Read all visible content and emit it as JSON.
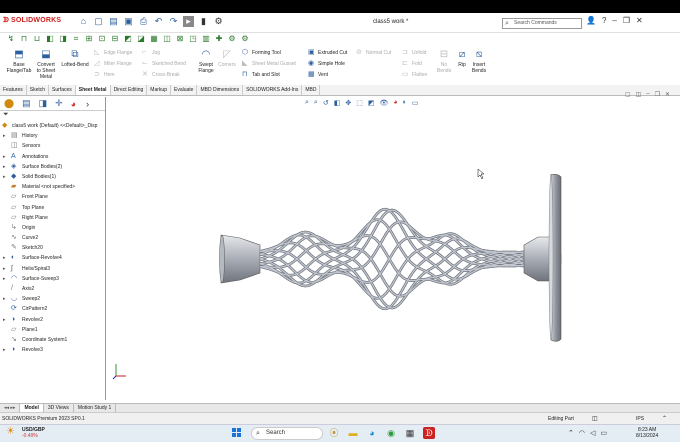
{
  "app": {
    "logo": "SOLIDWORKS",
    "doc_title": "class5 work *",
    "search_placeholder": "Search Commands"
  },
  "ribbon": {
    "large": [
      {
        "label1": "Base",
        "label2": "Flange/Tab",
        "enabled": true,
        "icon": "base-flange-icon"
      },
      {
        "label1": "Convert",
        "label2": "to Sheet",
        "label3": "Metal",
        "enabled": true,
        "icon": "convert-sheet-metal-icon"
      },
      {
        "label1": "Lofted-Bend",
        "label2": "",
        "enabled": true,
        "icon": "lofted-bend-icon"
      },
      {
        "label1": "Swept",
        "label2": "Flange",
        "enabled": true,
        "icon": "swept-flange-icon"
      },
      {
        "label1": "Corners",
        "label2": "",
        "enabled": false,
        "icon": "corners-icon"
      },
      {
        "label1": "Unfold",
        "label2": "",
        "enabled": false,
        "icon": "unfold-icon"
      },
      {
        "label1": "Fold",
        "label2": "",
        "enabled": false,
        "icon": "fold-icon"
      },
      {
        "label1": "Flatten",
        "label2": "",
        "enabled": false,
        "icon": "flatten-icon"
      },
      {
        "label1": "No",
        "label2": "Bends",
        "enabled": false,
        "icon": "no-bends-icon"
      },
      {
        "label1": "Rip",
        "label2": "",
        "enabled": true,
        "icon": "rip-icon"
      },
      {
        "label1": "Insert",
        "label2": "Bends",
        "enabled": true,
        "icon": "insert-bends-icon"
      }
    ],
    "small": [
      {
        "label": "Edge Flange",
        "enabled": false
      },
      {
        "label": "Miter Flange",
        "enabled": false
      },
      {
        "label": "Hem",
        "enabled": false
      },
      {
        "label": "Jog",
        "enabled": false
      },
      {
        "label": "Sketched Bend",
        "enabled": false
      },
      {
        "label": "Cross-Break",
        "enabled": false
      },
      {
        "label": "Forming Tool",
        "enabled": true
      },
      {
        "label": "Sheet Metal Gusset",
        "enabled": false
      },
      {
        "label": "Tab and Slot",
        "enabled": true
      },
      {
        "label": "Extruded Cut",
        "enabled": true
      },
      {
        "label": "Simple Hole",
        "enabled": true
      },
      {
        "label": "Vent",
        "enabled": true
      },
      {
        "label": "Normal Cut",
        "enabled": false
      }
    ]
  },
  "tabs": [
    "Features",
    "Sketch",
    "Surfaces",
    "Sheet Metal",
    "Direct Editing",
    "Markup",
    "Evaluate",
    "MBD Dimensions",
    "SOLIDWORKS Add-Ins",
    "MBD"
  ],
  "active_tab": "Sheet Metal",
  "tree": {
    "root": "class5 work (Default) <<Default>_Disp",
    "items": [
      {
        "label": "History",
        "icon": "history-icon",
        "expandable": true
      },
      {
        "label": "Sensors",
        "icon": "sensors-icon",
        "expandable": false
      },
      {
        "label": "Annotations",
        "icon": "annotations-icon",
        "expandable": true
      },
      {
        "label": "Surface Bodies(2)",
        "icon": "surface-bodies-icon",
        "expandable": true
      },
      {
        "label": "Solid Bodies(1)",
        "icon": "solid-bodies-icon",
        "expandable": true
      },
      {
        "label": "Material <not specified>",
        "icon": "material-icon",
        "expandable": false
      },
      {
        "label": "Front Plane",
        "icon": "plane-icon",
        "expandable": false
      },
      {
        "label": "Top Plane",
        "icon": "plane-icon",
        "expandable": false
      },
      {
        "label": "Right Plane",
        "icon": "plane-icon",
        "expandable": false
      },
      {
        "label": "Origin",
        "icon": "origin-icon",
        "expandable": false
      },
      {
        "label": "Curve2",
        "icon": "curve-icon",
        "expandable": false
      },
      {
        "label": "Sketch20",
        "icon": "sketch-icon",
        "expandable": false
      },
      {
        "label": "Surface-Revolve4",
        "icon": "surface-revolve-icon",
        "expandable": true
      },
      {
        "label": "Helix/Spiral3",
        "icon": "helix-icon",
        "expandable": true
      },
      {
        "label": "Surface-Sweep3",
        "icon": "surface-sweep-icon",
        "expandable": true
      },
      {
        "label": "Axis2",
        "icon": "axis-icon",
        "expandable": false
      },
      {
        "label": "Sweep2",
        "icon": "sweep-icon",
        "expandable": true
      },
      {
        "label": "CirPattern2",
        "icon": "circular-pattern-icon",
        "expandable": false
      },
      {
        "label": "Revolve2",
        "icon": "revolve-icon",
        "expandable": true
      },
      {
        "label": "Plane1",
        "icon": "plane-icon",
        "expandable": false
      },
      {
        "label": "Coordinate System1",
        "icon": "coordinate-system-icon",
        "expandable": false
      },
      {
        "label": "Revolve3",
        "icon": "revolve-icon",
        "expandable": true
      }
    ]
  },
  "bottom_tabs": [
    "Model",
    "3D Views",
    "Motion Study 1"
  ],
  "active_bottom_tab": "Model",
  "status": {
    "left": "SOLIDWORKS Premium 2023 SP0.1",
    "mode": "Editing Part",
    "units": "IPS"
  },
  "taskbar": {
    "ticker": "USD/GBP",
    "change": "-0.49%",
    "search": "Search",
    "time": "8:23 AM",
    "date": "8/13/2024"
  },
  "colors": {
    "brand_red": "#d02020",
    "accent_blue": "#2c5f9e",
    "model_gray": "#9aa0aa"
  }
}
